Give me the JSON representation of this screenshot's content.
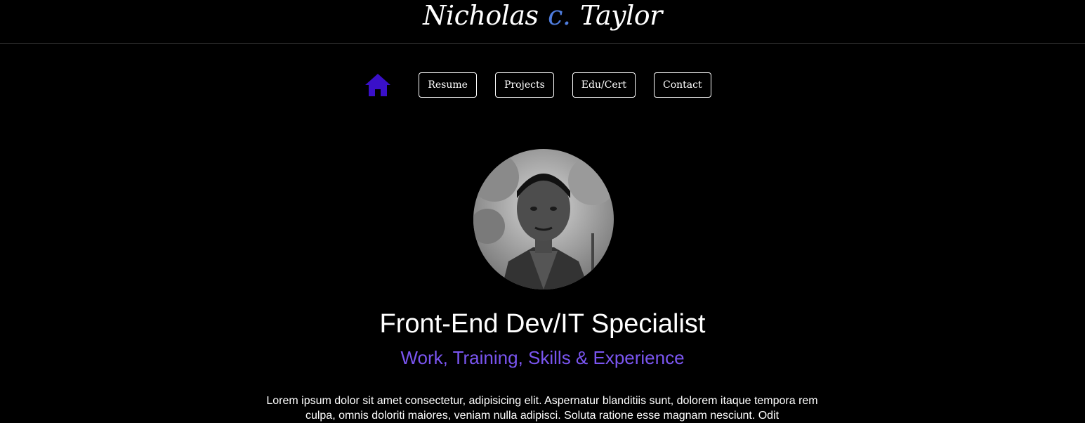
{
  "header": {
    "logo_first": "Nicholas",
    "logo_middle": "c.",
    "logo_last": "Taylor"
  },
  "nav": {
    "home_icon": "home-icon",
    "items": [
      {
        "label": "Resume"
      },
      {
        "label": "Projects"
      },
      {
        "label": "Edu/Cert"
      },
      {
        "label": "Contact"
      }
    ]
  },
  "hero": {
    "avatar_icon": "profile-photo",
    "title": "Front-End Dev/IT Specialist",
    "subtitle": "Work, Training, Skills & Experience",
    "body": "Lorem ipsum dolor sit amet consectetur, adipisicing elit. Aspernatur blanditiis sunt, dolorem itaque tempora rem culpa, omnis doloriti maiores, veniam nulla adipisci. Soluta ratione esse magnam nesciunt. Odit"
  },
  "colors": {
    "background": "#000000",
    "accent_purple": "#7a55f0",
    "home_icon": "#3a10c9",
    "logo_middle": "#4f7dde"
  }
}
